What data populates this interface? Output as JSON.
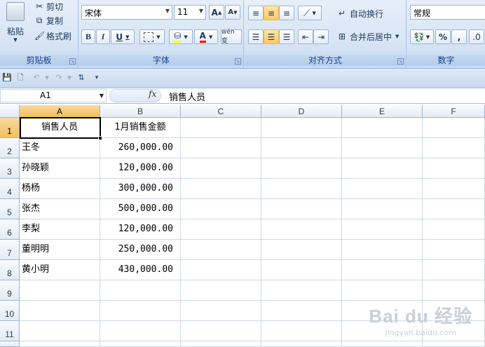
{
  "ribbon": {
    "clipboard": {
      "paste": "粘贴",
      "cut": "剪切",
      "copy": "复制",
      "format_painter": "格式刷",
      "group_label": "剪贴板"
    },
    "font": {
      "font_name": "宋体",
      "font_size": "11",
      "grow": "A",
      "shrink": "A",
      "bold": "B",
      "italic": "I",
      "underline": "U",
      "font_color": "A",
      "wen": "wén 变",
      "group_label": "字体"
    },
    "alignment": {
      "wrap_text": "自动换行",
      "merge_center": "合并后居中",
      "group_label": "对齐方式"
    },
    "number": {
      "format": "常规",
      "percent": "%",
      "comma": ",",
      "group_label": "数字"
    }
  },
  "formula_bar": {
    "name_box": "A1",
    "fx": "fx",
    "content": "销售人员"
  },
  "sheet": {
    "columns": [
      "A",
      "B",
      "C",
      "D",
      "E",
      "F"
    ],
    "rows": [
      "1",
      "2",
      "3",
      "4",
      "5",
      "6",
      "7",
      "8",
      "9",
      "10",
      "11"
    ],
    "header": [
      "销售人员",
      "1月销售金额"
    ],
    "data": [
      [
        "王冬",
        "260,000.00"
      ],
      [
        "孙晓颖",
        "120,000.00"
      ],
      [
        "杨杨",
        "300,000.00"
      ],
      [
        "张杰",
        "500,000.00"
      ],
      [
        "李梨",
        "120,000.00"
      ],
      [
        "董明明",
        "250,000.00"
      ],
      [
        "黄小明",
        "430,000.00"
      ]
    ]
  },
  "watermark": {
    "brand": "Bai du 经验",
    "url": "jingyan.baidu.com"
  },
  "colors": {
    "selection_header": "#f1c15f",
    "ribbon": "#d9e6f6",
    "gridline": "#d0d7e5"
  }
}
